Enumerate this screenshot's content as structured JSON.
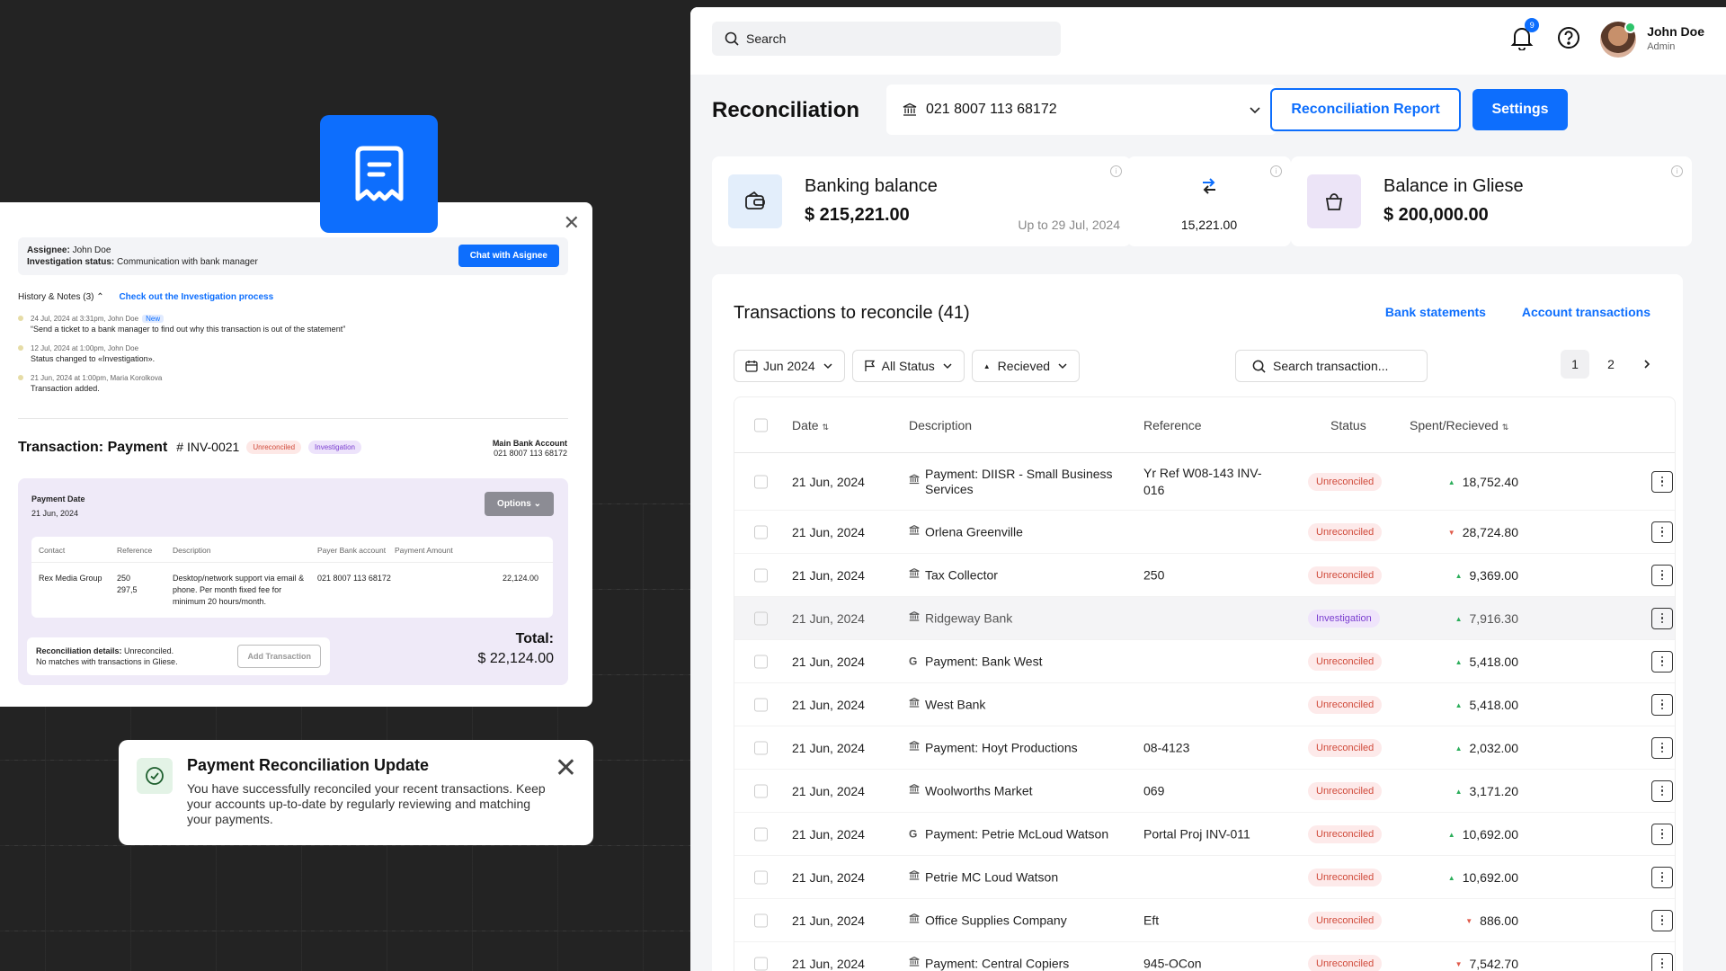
{
  "detail": {
    "assignee_label": "Assignee:",
    "assignee": "John Doe",
    "status_label": "Investigation status:",
    "status": "Communication with bank manager",
    "chat_button": "Chat with Asignee",
    "history_label": "History & Notes",
    "history_count": "(3)",
    "history_link": "Check out the Investigation process",
    "notes": [
      {
        "meta": "24 Jul, 2024 at 3:31pm, John Doe",
        "badge": "New",
        "text": "“Send a ticket to a bank manager to find out why this transaction is out of the statement”"
      },
      {
        "meta": "12 Jul, 2024 at 1:00pm, John Doe",
        "badge": "",
        "text": "Status changed to «Investigation»."
      },
      {
        "meta": "21 Jun, 2024 at 1:00pm, Maria Korolkova",
        "badge": "",
        "text": "Transaction added."
      }
    ],
    "tx_title": "Transaction: Payment",
    "tx_number": "# INV-0021",
    "tx_badge_1": "Unreconciled",
    "tx_badge_2": "Investigation",
    "main_account_label": "Main Bank Account",
    "main_account": "021 8007 113 68172",
    "payment_date_label": "Payment Date",
    "payment_date": "21 Jun, 2024",
    "options_button": "Options",
    "pt_headers": [
      "Contact",
      "Reference",
      "Description",
      "Payer Bank account",
      "Payment Amount"
    ],
    "pt_row": {
      "contact": "Rex Media Group",
      "reference": "250\n297,5",
      "description": "Desktop/network support via email & phone. Per month fixed fee for minimum 20 hours/month.",
      "payer_account": "021 8007 113 68172",
      "amount": "22,124.00"
    },
    "recon_label": "Reconciliation details:",
    "recon_status": "Unreconciled.",
    "recon_note": "No matches with transactions in Gliese.",
    "add_tx_button": "Add Transaction",
    "total_label": "Total:",
    "total_value": "$ 22,124.00"
  },
  "toast": {
    "title": "Payment Reconciliation Update",
    "body": "You have successfully reconciled your recent transactions. Keep your accounts up-to-date by regularly reviewing and matching your payments."
  },
  "topbar": {
    "search_placeholder": "Search",
    "notification_count": "9",
    "user_name": "John Doe",
    "user_role": "Admin"
  },
  "header": {
    "title": "Reconciliation",
    "account": "021 8007 113 68172",
    "report_button": "Reconciliation Report",
    "settings_button": "Settings"
  },
  "balances": {
    "banking_label": "Banking balance",
    "banking_amount": "$ 215,221.00",
    "banking_date": "Up to 29 Jul, 2024",
    "difference": "15,221.00",
    "gliese_label": "Balance in Gliese",
    "gliese_amount": "$ 200,000.00"
  },
  "transactions": {
    "title": "Transactions to reconcile (41)",
    "link_1": "Bank statements",
    "link_2": "Account transactions",
    "filter_month": "Jun 2024",
    "filter_status": "All Status",
    "filter_direction": "Recieved",
    "search_placeholder": "Search transaction...",
    "pages": [
      "1",
      "2"
    ],
    "columns": [
      "Date",
      "Description",
      "Reference",
      "Status",
      "Spent/Recieved"
    ],
    "rows": [
      {
        "date": "21 Jun, 2024",
        "icon": "bank",
        "desc": "Payment: DIISR - Small Business Services",
        "ref": "Yr Ref W08-143 INV-016",
        "status": "Unreconciled",
        "dir": "up",
        "amount": "18,752.40"
      },
      {
        "date": "21 Jun, 2024",
        "icon": "bank",
        "desc": "Orlena Greenville",
        "ref": "",
        "status": "Unreconciled",
        "dir": "down",
        "amount": "28,724.80"
      },
      {
        "date": "21 Jun, 2024",
        "icon": "bank",
        "desc": "Tax Collector",
        "ref": "250",
        "status": "Unreconciled",
        "dir": "up",
        "amount": "9,369.00"
      },
      {
        "date": "21 Jun, 2024",
        "icon": "bank",
        "desc": "Ridgeway Bank",
        "ref": "",
        "status": "Investigation",
        "dir": "up",
        "amount": "7,916.30"
      },
      {
        "date": "21 Jun, 2024",
        "icon": "g",
        "desc": "Payment: Bank West",
        "ref": "",
        "status": "Unreconciled",
        "dir": "up",
        "amount": "5,418.00"
      },
      {
        "date": "21 Jun, 2024",
        "icon": "bank",
        "desc": "West Bank",
        "ref": "",
        "status": "Unreconciled",
        "dir": "up",
        "amount": "5,418.00"
      },
      {
        "date": "21 Jun, 2024",
        "icon": "bank",
        "desc": "Payment: Hoyt Productions",
        "ref": "08-4123",
        "status": "Unreconciled",
        "dir": "up",
        "amount": "2,032.00"
      },
      {
        "date": "21 Jun, 2024",
        "icon": "bank",
        "desc": "Woolworths Market",
        "ref": "069",
        "status": "Unreconciled",
        "dir": "up",
        "amount": "3,171.20"
      },
      {
        "date": "21 Jun, 2024",
        "icon": "g",
        "desc": "Payment: Petrie McLoud Watson",
        "ref": "Portal Proj INV-011",
        "status": "Unreconciled",
        "dir": "up",
        "amount": "10,692.00"
      },
      {
        "date": "21 Jun, 2024",
        "icon": "bank",
        "desc": "Petrie MC Loud Watson",
        "ref": "",
        "status": "Unreconciled",
        "dir": "up",
        "amount": "10,692.00"
      },
      {
        "date": "21 Jun, 2024",
        "icon": "bank",
        "desc": "Office Supplies Company",
        "ref": "Eft",
        "status": "Unreconciled",
        "dir": "down",
        "amount": "886.00"
      },
      {
        "date": "21 Jun, 2024",
        "icon": "bank",
        "desc": "Payment: Central Copiers",
        "ref": "945-OCon",
        "status": "Unreconciled",
        "dir": "down",
        "amount": "7,542.70"
      }
    ]
  }
}
